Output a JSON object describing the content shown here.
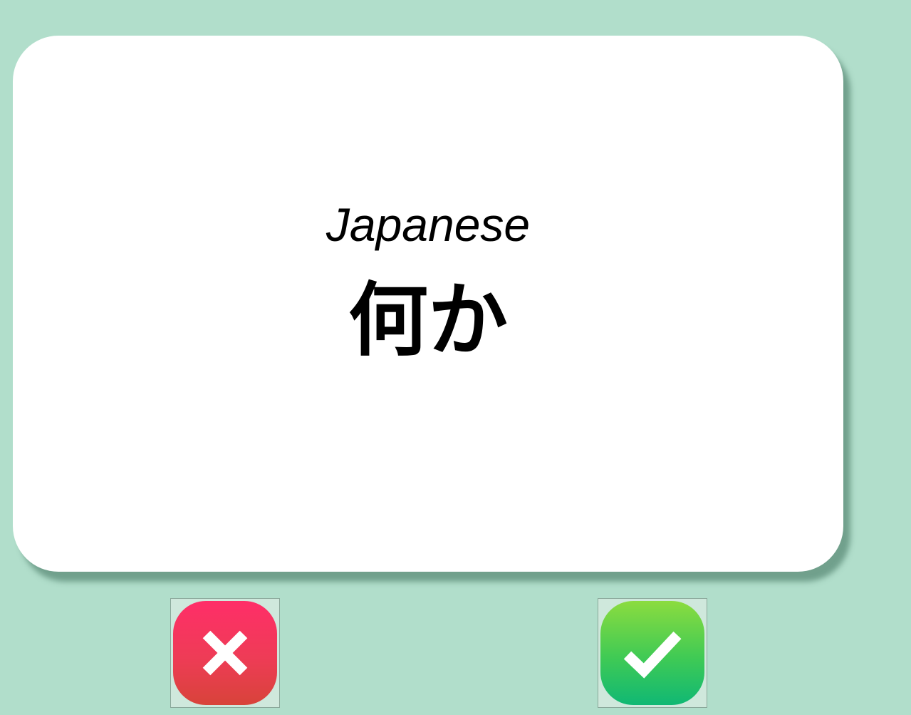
{
  "card": {
    "language": "Japanese",
    "term": "何か"
  },
  "buttons": {
    "wrong_icon": "close-icon",
    "right_icon": "check-icon"
  },
  "colors": {
    "background": "#b1decb",
    "wrong": "#ee3c56",
    "right": "#3fca55"
  }
}
